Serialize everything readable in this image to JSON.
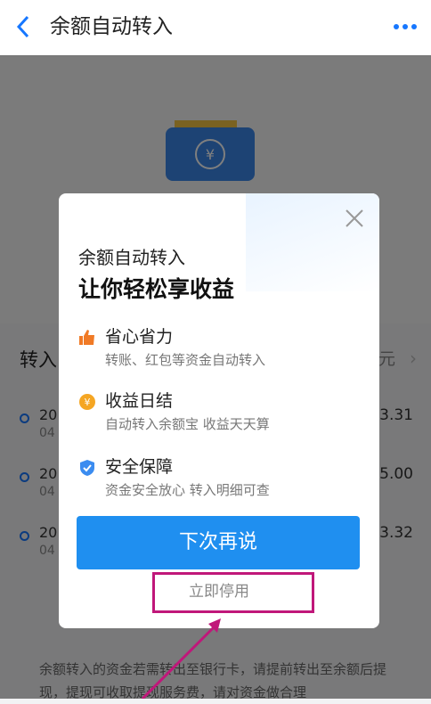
{
  "header": {
    "title": "余额自动转入"
  },
  "list": {
    "title": "转入",
    "right_label": "元",
    "records": [
      {
        "date": "20",
        "sub": "04",
        "amount": "93.31"
      },
      {
        "date": "20",
        "sub": "04",
        "amount": "15.00"
      },
      {
        "date": "20",
        "sub": "04",
        "amount": "03.32"
      }
    ]
  },
  "note": "余额转入的资金若需转出至银行卡，请提前转出至余额后提现，提现可收取提现服务费，请对资金做合理",
  "modal": {
    "subtitle": "余额自动转入",
    "headline": "让你轻松享收益",
    "features": [
      {
        "title": "省心省力",
        "desc": "转账、红包等资金自动转入",
        "icon": "thumbs-up-icon",
        "color": "#f07a26"
      },
      {
        "title": "收益日结",
        "desc": "自动转入余额宝 收益天天算",
        "icon": "coin-icon",
        "color": "#f5a623"
      },
      {
        "title": "安全保障",
        "desc": "资金安全放心 转入明细可查",
        "icon": "shield-icon",
        "color": "#3b8cf0"
      }
    ],
    "primary_button": "下次再说",
    "secondary_link": "立即停用"
  },
  "colors": {
    "accent": "#1f8ff0",
    "highlight": "#c0177a"
  }
}
